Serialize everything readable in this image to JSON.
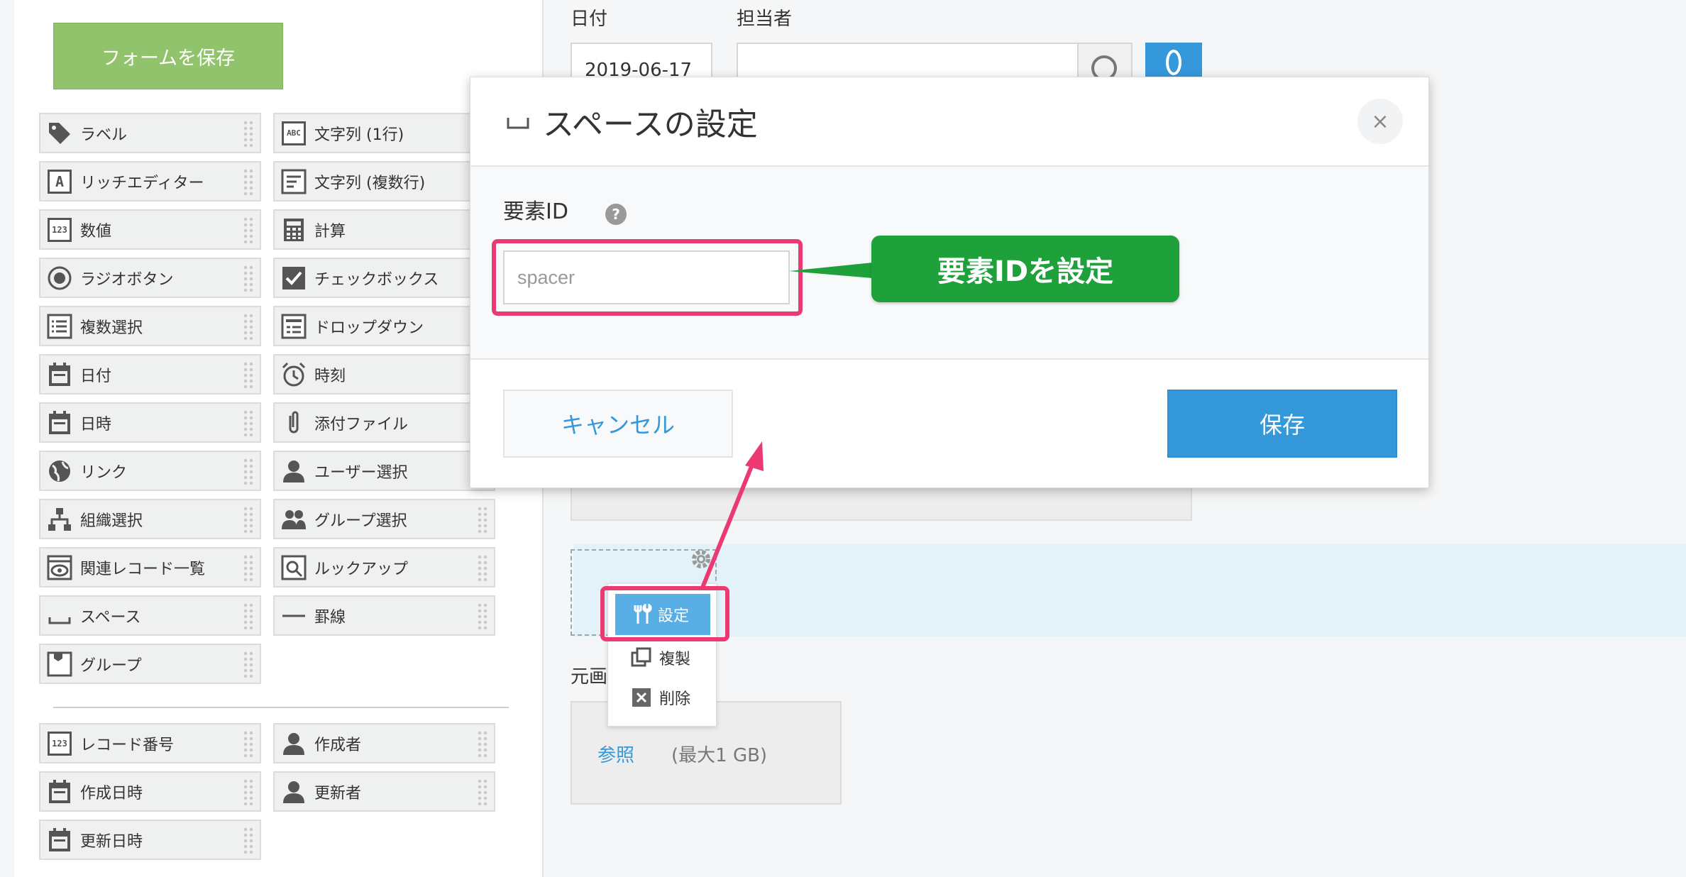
{
  "palette": {
    "save_form_label": "フォームを保存",
    "fields": [
      {
        "label": "ラベル",
        "icon": "tag-icon"
      },
      {
        "label": "文字列 (1行)",
        "icon": "abc-text-icon"
      },
      {
        "label": "リッチエディター",
        "icon": "rich-editor-icon"
      },
      {
        "label": "文字列 (複数行)",
        "icon": "multiline-text-icon"
      },
      {
        "label": "数値",
        "icon": "number-icon"
      },
      {
        "label": "計算",
        "icon": "calculator-icon"
      },
      {
        "label": "ラジオボタン",
        "icon": "radio-button-icon"
      },
      {
        "label": "チェックボックス",
        "icon": "checkbox-icon"
      },
      {
        "label": "複数選択",
        "icon": "multi-select-icon"
      },
      {
        "label": "ドロップダウン",
        "icon": "dropdown-icon"
      },
      {
        "label": "日付",
        "icon": "calendar-icon"
      },
      {
        "label": "時刻",
        "icon": "alarm-clock-icon"
      },
      {
        "label": "日時",
        "icon": "calendar-icon"
      },
      {
        "label": "添付ファイル",
        "icon": "paperclip-icon"
      },
      {
        "label": "リンク",
        "icon": "globe-icon"
      },
      {
        "label": "ユーザー選択",
        "icon": "user-icon"
      },
      {
        "label": "組織選択",
        "icon": "org-chart-icon"
      },
      {
        "label": "グループ選択",
        "icon": "group-icon"
      },
      {
        "label": "関連レコード一覧",
        "icon": "related-records-icon"
      },
      {
        "label": "ルックアップ",
        "icon": "lookup-icon"
      },
      {
        "label": "スペース",
        "icon": "space-icon"
      },
      {
        "label": "罫線",
        "icon": "horizontal-line-icon"
      },
      {
        "label": "グループ",
        "icon": "group-box-icon"
      }
    ],
    "system_fields": [
      {
        "label": "レコード番号",
        "icon": "number-icon"
      },
      {
        "label": "作成者",
        "icon": "user-icon"
      },
      {
        "label": "作成日時",
        "icon": "calendar-icon"
      },
      {
        "label": "更新者",
        "icon": "user-icon"
      },
      {
        "label": "更新日時",
        "icon": "calendar-icon"
      }
    ]
  },
  "canvas": {
    "date_label": "日付",
    "date_value": "2019-06-17",
    "assignee_label": "担当者",
    "attach_label": "元画",
    "attach_browse": "参照",
    "attach_max": "(最大1 GB)",
    "context_menu": {
      "settings": "設定",
      "duplicate": "複製",
      "delete": "削除"
    }
  },
  "modal": {
    "title": "スペースの設定",
    "element_id_label": "要素ID",
    "element_id_value": "spacer",
    "cancel_label": "キャンセル",
    "save_label": "保存",
    "close_symbol": "×",
    "help_symbol": "?"
  },
  "annotation": {
    "callout_text": "要素IDを設定"
  },
  "colors": {
    "save_form_green": "#91c36c",
    "primary_blue": "#3498db",
    "highlight_pink": "#ea3a71",
    "callout_green": "#1ea03a"
  }
}
